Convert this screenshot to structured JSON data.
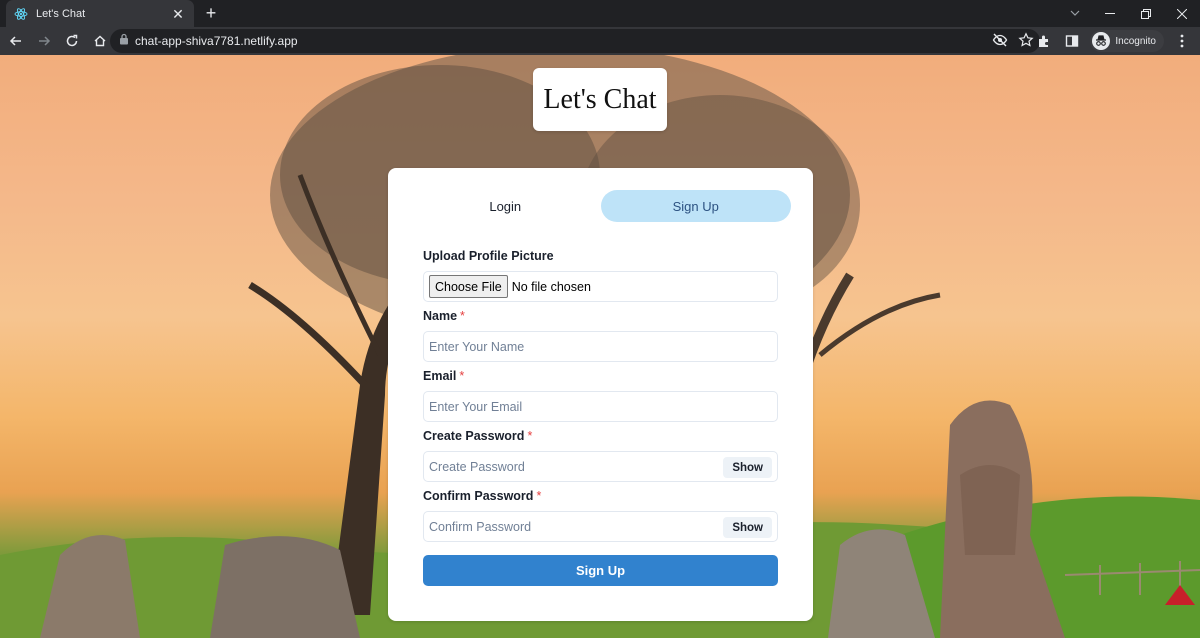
{
  "browser": {
    "tab_title": "Let's Chat",
    "url": "chat-app-shiva7781.netlify.app",
    "profile_label": "Incognito"
  },
  "page": {
    "brand_title": "Let's Chat"
  },
  "auth_tabs": {
    "login_label": "Login",
    "signup_label": "Sign Up",
    "active": "Sign Up"
  },
  "form": {
    "picture_label": "Upload Profile Picture",
    "file_button": "Choose File",
    "file_status": "No file chosen",
    "name_label": "Name",
    "name_placeholder": "Enter Your Name",
    "email_label": "Email",
    "email_placeholder": "Enter Your Email",
    "password_label": "Create Password",
    "password_placeholder": "Create Password",
    "confirm_label": "Confirm Password",
    "confirm_placeholder": "Confirm Password",
    "show_label": "Show",
    "required_mark": "*",
    "submit_label": "Sign Up"
  },
  "colors": {
    "active_tab_bg": "#bee3f8",
    "primary_button": "#3182ce",
    "required": "#e53e3e"
  },
  "icons": [
    "react-favicon-icon",
    "close-icon",
    "plus-icon",
    "back-icon",
    "forward-icon",
    "reload-icon",
    "home-icon",
    "lock-icon",
    "eye-off-icon",
    "star-icon",
    "extensions-icon",
    "side-panel-icon",
    "incognito-icon",
    "menu-icon"
  ]
}
